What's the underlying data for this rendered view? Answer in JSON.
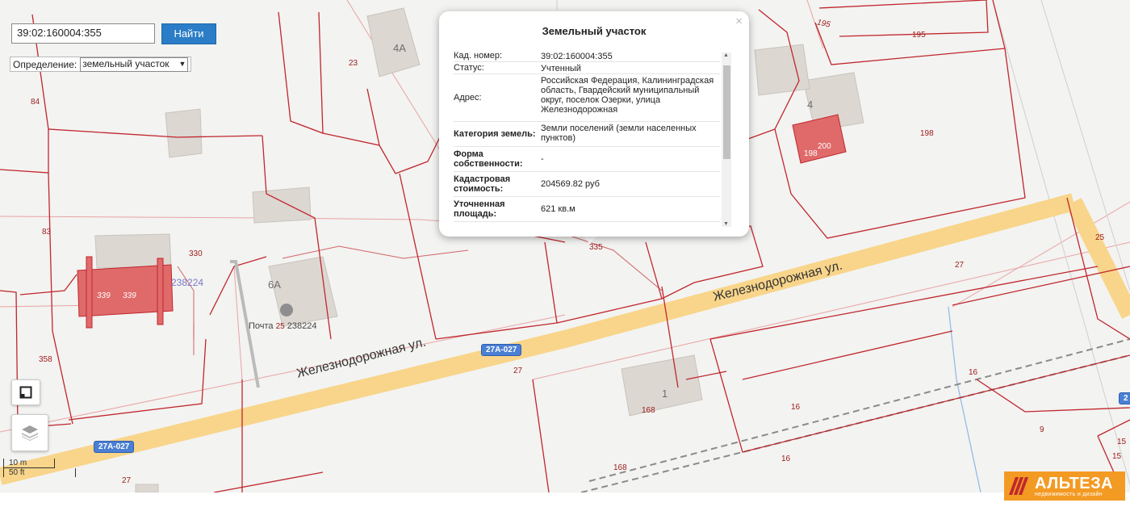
{
  "search": {
    "value": "39:02:160004:355",
    "button_label": "Найти"
  },
  "definition": {
    "label": "Определение:",
    "selected": "земельный участок"
  },
  "parcel_labels": [
    "23",
    "84",
    "83",
    "330",
    "358",
    "27",
    "195",
    "198",
    "198",
    "200",
    "25",
    "27",
    "27",
    "16",
    "16",
    "9",
    "15",
    "15",
    "168",
    "168",
    "16",
    "335"
  ],
  "building_labels": [
    "4А",
    "4",
    "6А",
    "1"
  ],
  "streets": [
    "Железнодорожная ул.",
    "Железнодорожная ул."
  ],
  "road_shields": [
    "27А-027",
    "27А-027"
  ],
  "poi": {
    "post_label": "Почта",
    "post_code": "238224",
    "parcel_25": "25",
    "bld_339a": "339",
    "bld_339b": "339",
    "postcode_label": "238224"
  },
  "scale": {
    "metric": "10 m",
    "imperial": "50 ft"
  },
  "popup": {
    "title": "Земельный участок",
    "rows": [
      {
        "key": "Кад. номер:",
        "value": "39:02:160004:355"
      },
      {
        "key": "Статус:",
        "value": "Учтенный"
      },
      {
        "key": "Адрес:",
        "value": "Российская Федерация, Калининградская область, Гвардейский муниципальный округ, поселок Озерки, улица Железнодорожная"
      },
      {
        "key": "Категория земель:",
        "value": "Земли поселений (земли населенных пунктов)"
      },
      {
        "key": "Форма собственности:",
        "value": "-"
      },
      {
        "key": "Кадастровая стоимость:",
        "value": "204569.82 руб"
      },
      {
        "key": "Уточненная площадь:",
        "value": "621 кв.м"
      }
    ],
    "close": "×"
  },
  "brand": {
    "name": "АЛЬТЕЗА",
    "tagline": "недвижимость и дизайн"
  },
  "colors": {
    "boundary": "#c0262d",
    "road": "#f8d58a",
    "building": "#d9d5d0",
    "highlight": "#e06a6a",
    "accent": "#2a7dc6",
    "brand": "#f39a23"
  }
}
